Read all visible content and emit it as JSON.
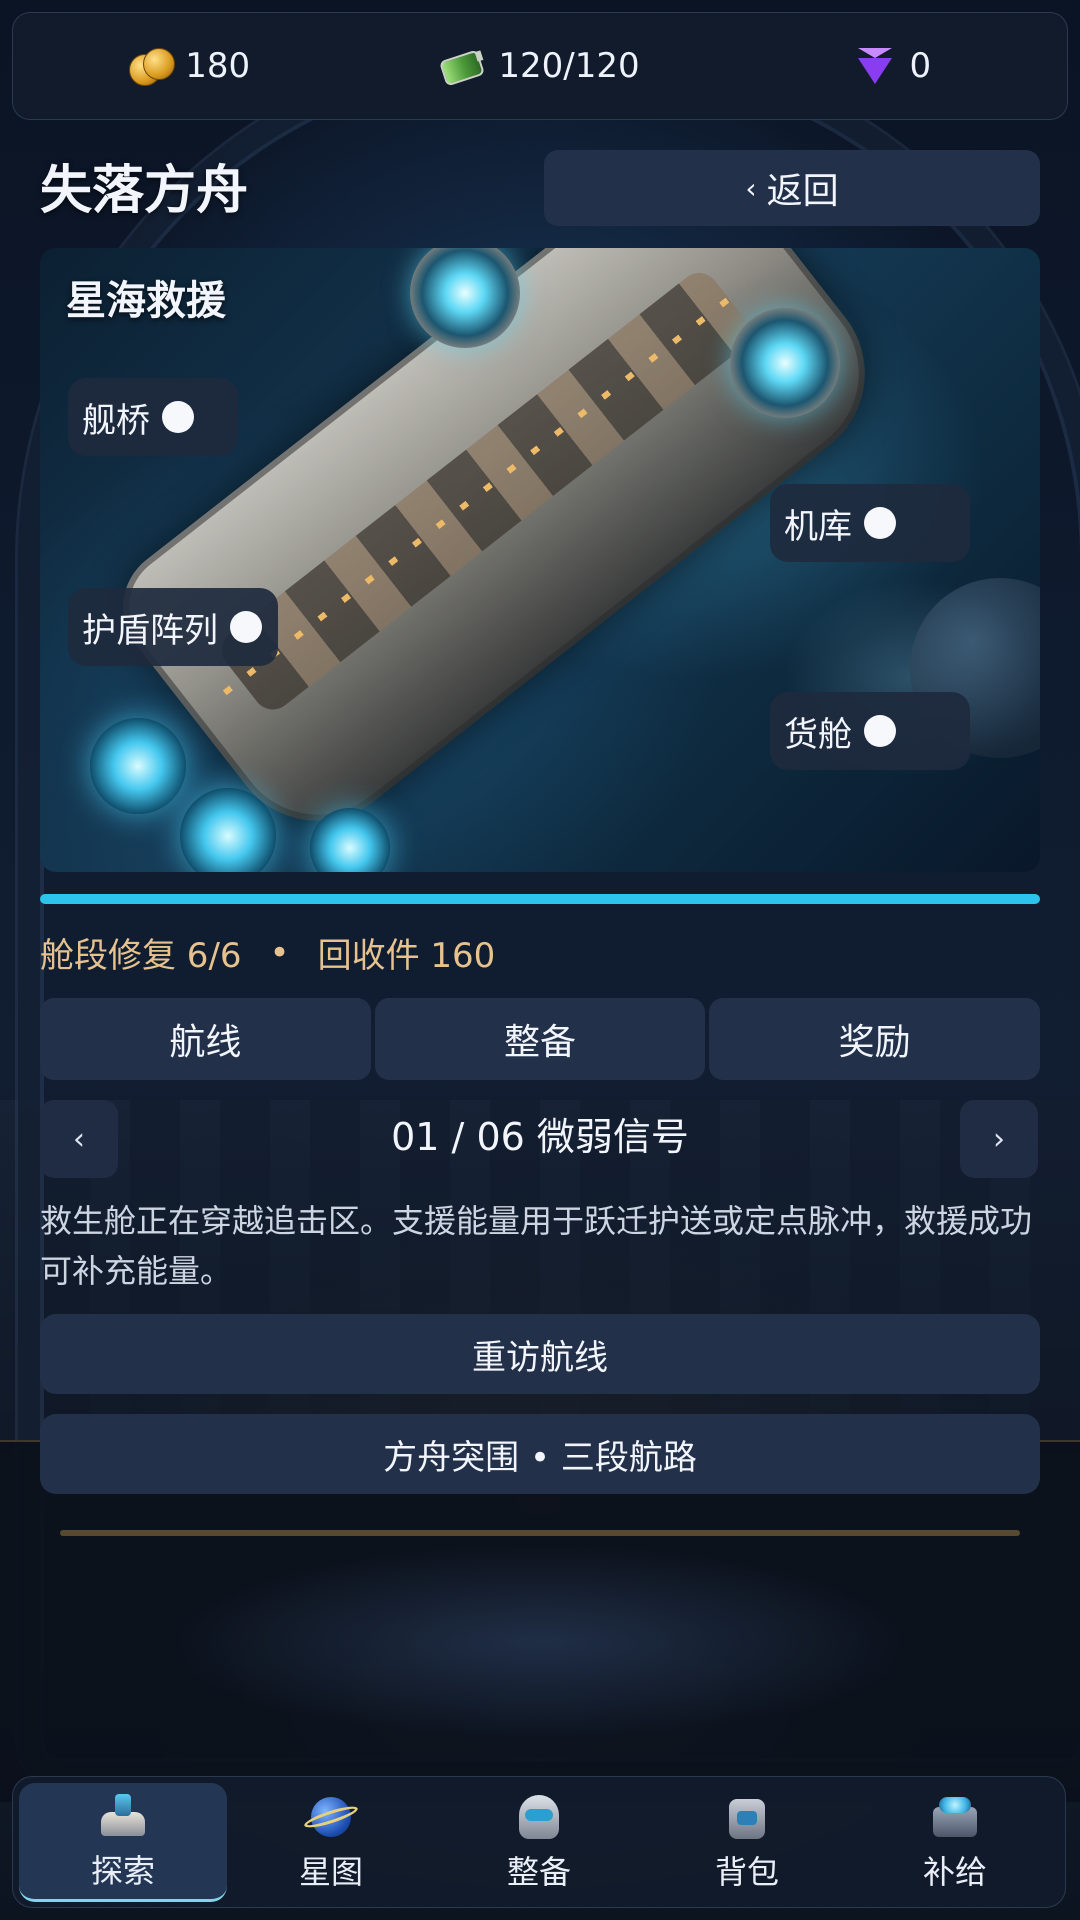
{
  "resources": [
    {
      "icon": "coin-icon",
      "value": "180"
    },
    {
      "icon": "battery-icon",
      "value": "120/120"
    },
    {
      "icon": "gem-icon",
      "value": "0"
    }
  ],
  "header": {
    "title": "失落方舟",
    "back_chevron": "‹",
    "back_label": "返回"
  },
  "ship": {
    "title": "星海救援",
    "sections": [
      {
        "label": "舰桥"
      },
      {
        "label": "机库"
      },
      {
        "label": "护盾阵列"
      },
      {
        "label": "货舱"
      }
    ]
  },
  "progress": {
    "fraction": 1.0,
    "repair_text": "舱段修复 6/6",
    "separator": "•",
    "salvage_text": "回收件 160"
  },
  "tabs": [
    {
      "label": "航线"
    },
    {
      "label": "整备"
    },
    {
      "label": "奖励"
    }
  ],
  "level": {
    "prev": "‹",
    "next": "›",
    "title": "01 / 06  微弱信号",
    "description": "救生舱正在穿越追击区。支援能量用于跃迁护送或定点脉冲，救援成功可补充能量。"
  },
  "actions": {
    "revisit": "重访航线",
    "breakout": "方舟突围 • 三段航路"
  },
  "bottom_nav": [
    {
      "icon": "base-icon",
      "label": "探索",
      "active": true
    },
    {
      "icon": "planet-icon",
      "label": "星图",
      "active": false
    },
    {
      "icon": "helmet-icon",
      "label": "整备",
      "active": false
    },
    {
      "icon": "pack-icon",
      "label": "背包",
      "active": false
    },
    {
      "icon": "chest-icon",
      "label": "补给",
      "active": false
    }
  ],
  "colors": {
    "accent": "#2cc3ec",
    "status_text": "#e6c28e",
    "panel": "#22304a"
  }
}
